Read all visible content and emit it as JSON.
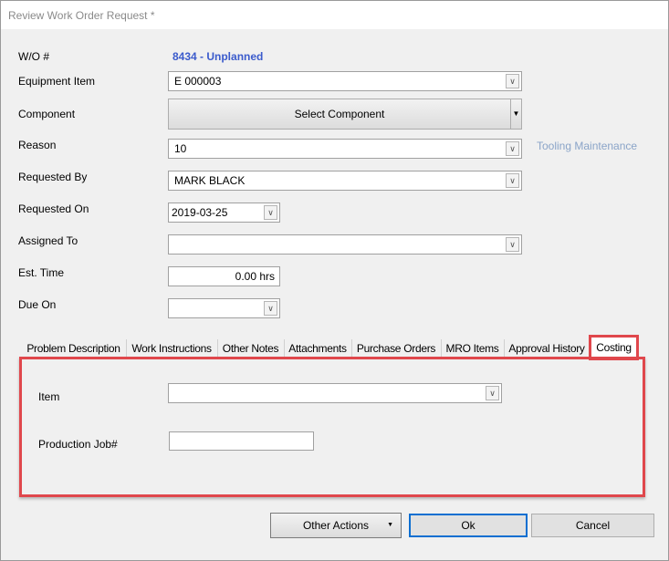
{
  "window": {
    "title": "Review Work Order Request *"
  },
  "form": {
    "wo_label": "W/O #",
    "wo_value": "8434 - Unplanned",
    "equipment_label": "Equipment Item",
    "equipment_value": "E 000003",
    "component_label": "Component",
    "component_button": "Select Component",
    "reason_label": "Reason",
    "reason_value": "10",
    "reason_desc": "Tooling Maintenance",
    "requested_by_label": "Requested By",
    "requested_by_value": "MARK BLACK",
    "requested_on_label": "Requested On",
    "requested_on_value": "2019-03-25",
    "assigned_to_label": "Assigned To",
    "assigned_to_value": "",
    "est_time_label": "Est. Time",
    "est_time_value": "0.00 hrs",
    "due_on_label": "Due On",
    "due_on_value": ""
  },
  "tabs": [
    {
      "label": "Problem Description"
    },
    {
      "label": "Work Instructions"
    },
    {
      "label": "Other Notes"
    },
    {
      "label": "Attachments"
    },
    {
      "label": "Purchase Orders"
    },
    {
      "label": "MRO Items"
    },
    {
      "label": "Approval History"
    },
    {
      "label": "Costing",
      "selected": true
    }
  ],
  "costing": {
    "item_label": "Item",
    "item_value": "",
    "job_label": "Production Job#",
    "job_value": ""
  },
  "buttons": {
    "other_actions": "Other Actions",
    "ok": "Ok",
    "cancel": "Cancel"
  },
  "colors": {
    "wo_value": "#3b5bcc",
    "highlight": "#e0474c",
    "reason_desc": "#8aa4c8",
    "ok_border": "#0a6fd1"
  }
}
